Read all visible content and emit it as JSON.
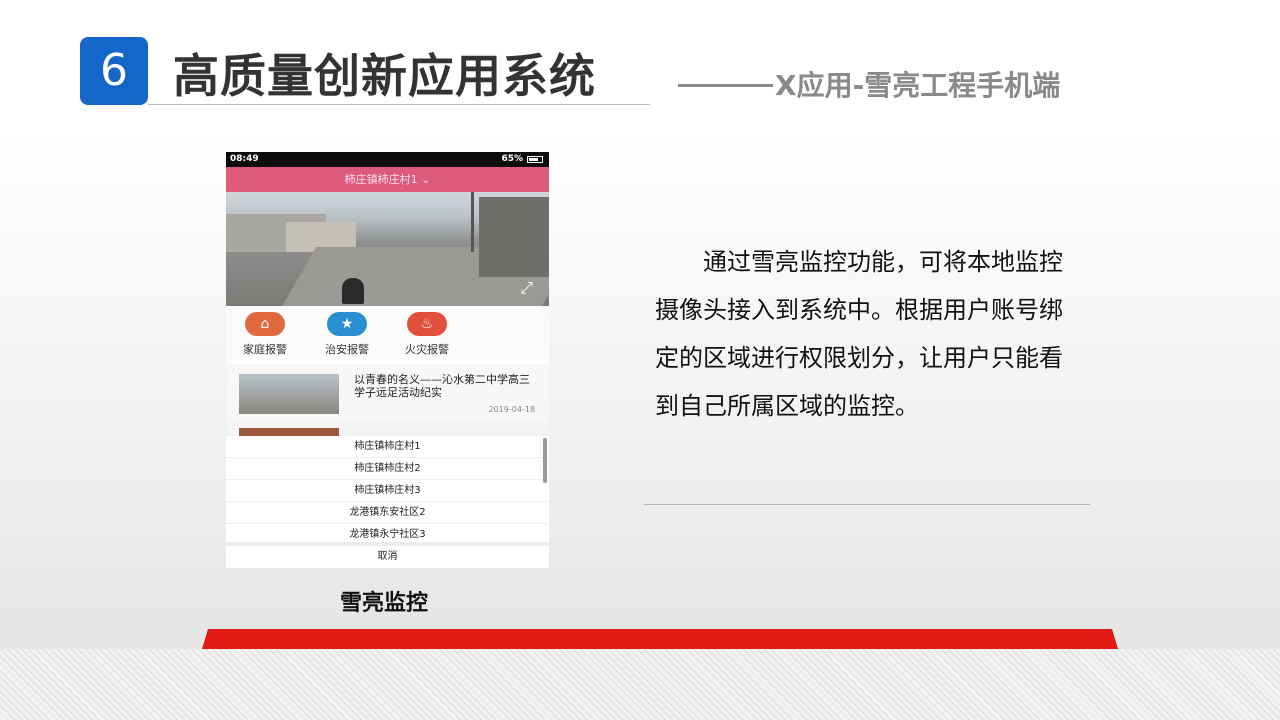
{
  "header": {
    "number": "6",
    "title": "高质量创新应用系统",
    "subtitle": "X应用-雪亮工程手机端"
  },
  "phone": {
    "status_time": "08:49",
    "status_right": "65%",
    "village_selector": "柿庄镇柿庄村1",
    "shortcuts": [
      {
        "label": "家庭报警",
        "icon": "home-icon",
        "color": "#e06a3b"
      },
      {
        "label": "治安报警",
        "icon": "police-star-icon",
        "color": "#2a8fd0"
      },
      {
        "label": "火灾报警",
        "icon": "fire-icon",
        "color": "#e0503b"
      }
    ],
    "news": [
      {
        "title": "以青春的名义——沁水第二中学高三学子远足活动纪实",
        "date": "2019-04-18"
      }
    ],
    "picker_options": [
      "柿庄镇柿庄村1",
      "柿庄镇柿庄村2",
      "柿庄镇柿庄村3",
      "龙港镇东安社区2",
      "龙港镇永宁社区3"
    ],
    "cancel_label": "取消"
  },
  "caption": "雪亮监控",
  "description": "通过雪亮监控功能，可将本地监控摄像头接入到系统中。根据用户账号绑定的区域进行权限划分，让用户只能看到自己所属区域的监控。",
  "colors": {
    "badge": "#1467c8",
    "accent_red": "#e11a16",
    "app_header": "#dd5a7d"
  }
}
